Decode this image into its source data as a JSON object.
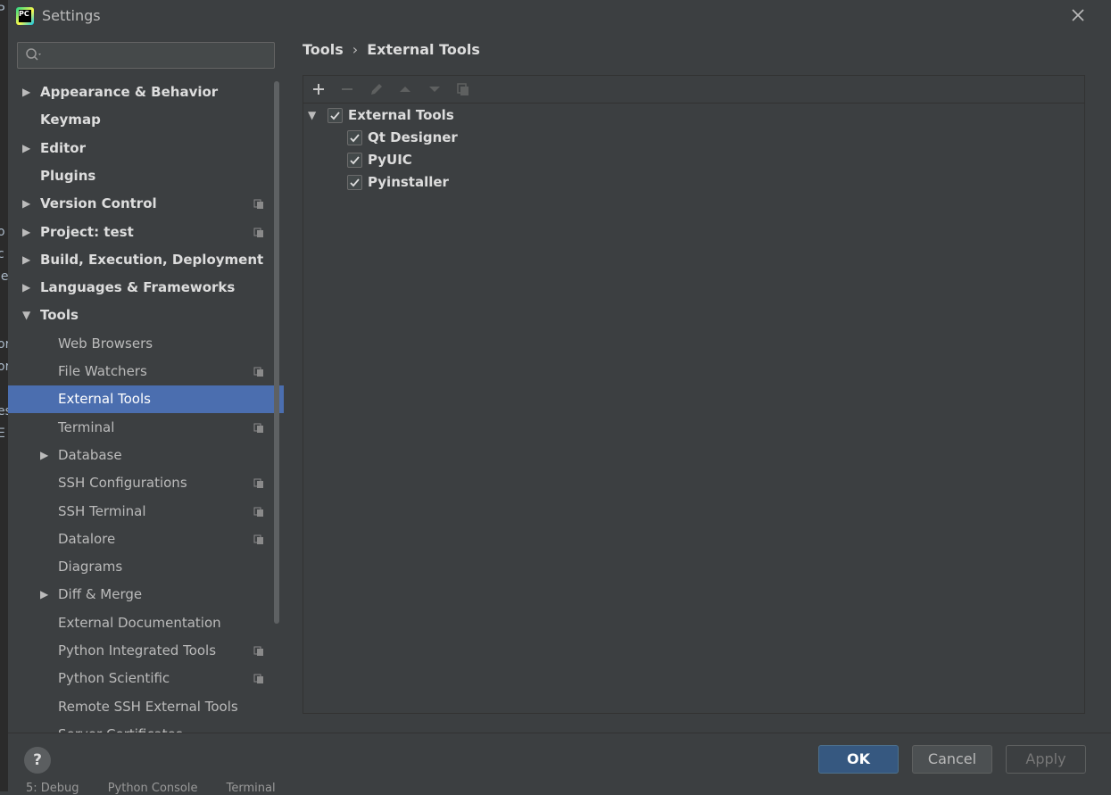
{
  "window": {
    "title": "Settings"
  },
  "sidebar": {
    "search": {
      "placeholder": "",
      "value": ""
    },
    "items": [
      {
        "label": "Appearance & Behavior",
        "level": 0,
        "arrow": "collapsed",
        "copy": false,
        "selected": false
      },
      {
        "label": "Keymap",
        "level": 0,
        "arrow": "none",
        "copy": false,
        "selected": false
      },
      {
        "label": "Editor",
        "level": 0,
        "arrow": "collapsed",
        "copy": false,
        "selected": false
      },
      {
        "label": "Plugins",
        "level": 0,
        "arrow": "none",
        "copy": false,
        "selected": false
      },
      {
        "label": "Version Control",
        "level": 0,
        "arrow": "collapsed",
        "copy": true,
        "selected": false
      },
      {
        "label": "Project: test",
        "level": 0,
        "arrow": "collapsed",
        "copy": true,
        "selected": false
      },
      {
        "label": "Build, Execution, Deployment",
        "level": 0,
        "arrow": "collapsed",
        "copy": false,
        "selected": false
      },
      {
        "label": "Languages & Frameworks",
        "level": 0,
        "arrow": "collapsed",
        "copy": false,
        "selected": false
      },
      {
        "label": "Tools",
        "level": 0,
        "arrow": "expanded",
        "copy": false,
        "selected": false
      },
      {
        "label": "Web Browsers",
        "level": 1,
        "arrow": "none",
        "copy": false,
        "selected": false
      },
      {
        "label": "File Watchers",
        "level": 1,
        "arrow": "none",
        "copy": true,
        "selected": false
      },
      {
        "label": "External Tools",
        "level": 1,
        "arrow": "none",
        "copy": false,
        "selected": true
      },
      {
        "label": "Terminal",
        "level": 1,
        "arrow": "none",
        "copy": true,
        "selected": false
      },
      {
        "label": "Database",
        "level": 1,
        "arrow": "collapsed",
        "copy": false,
        "selected": false
      },
      {
        "label": "SSH Configurations",
        "level": 1,
        "arrow": "none",
        "copy": true,
        "selected": false
      },
      {
        "label": "SSH Terminal",
        "level": 1,
        "arrow": "none",
        "copy": true,
        "selected": false
      },
      {
        "label": "Datalore",
        "level": 1,
        "arrow": "none",
        "copy": true,
        "selected": false
      },
      {
        "label": "Diagrams",
        "level": 1,
        "arrow": "none",
        "copy": false,
        "selected": false
      },
      {
        "label": "Diff & Merge",
        "level": 1,
        "arrow": "collapsed",
        "copy": false,
        "selected": false
      },
      {
        "label": "External Documentation",
        "level": 1,
        "arrow": "none",
        "copy": false,
        "selected": false
      },
      {
        "label": "Python Integrated Tools",
        "level": 1,
        "arrow": "none",
        "copy": true,
        "selected": false
      },
      {
        "label": "Python Scientific",
        "level": 1,
        "arrow": "none",
        "copy": true,
        "selected": false
      },
      {
        "label": "Remote SSH External Tools",
        "level": 1,
        "arrow": "none",
        "copy": false,
        "selected": false
      },
      {
        "label": "Server Certificates",
        "level": 1,
        "arrow": "none",
        "copy": false,
        "selected": false
      }
    ]
  },
  "breadcrumb": {
    "parent": "Tools",
    "separator": "›",
    "current": "External Tools"
  },
  "toolbar": {
    "add_icon": "+",
    "remove_icon": "−",
    "edit_icon": "pencil-icon",
    "up_icon": "▲",
    "down_icon": "▼",
    "copy_icon": "copy-icon"
  },
  "tools_tree": {
    "group": {
      "label": "External Tools",
      "checked": true
    },
    "children": [
      {
        "label": "Qt Designer",
        "checked": true
      },
      {
        "label": "PyUIC",
        "checked": true
      },
      {
        "label": "Pyinstaller",
        "checked": true
      }
    ]
  },
  "footer": {
    "help": "?",
    "ok": "OK",
    "cancel": "Cancel",
    "apply": "Apply",
    "bottom_tabs": [
      "5: Debug",
      "Python Console",
      "Terminal"
    ]
  },
  "colors": {
    "background": "#3c3f41",
    "selection": "#4b6eaf",
    "ok_button": "#365880"
  }
}
